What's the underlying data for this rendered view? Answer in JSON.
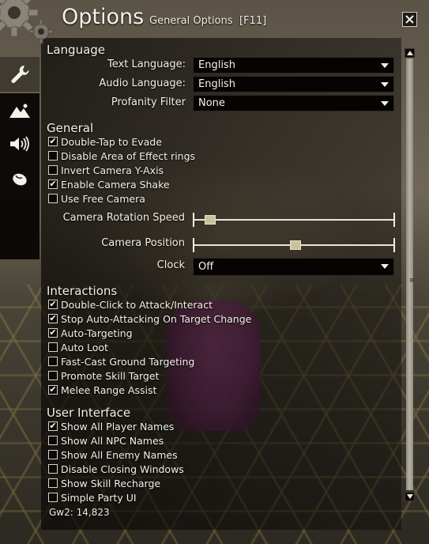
{
  "window": {
    "title": "Options",
    "subtitle": "General Options",
    "hotkey": "[F11]",
    "close_icon": "close-icon"
  },
  "tabs": [
    {
      "icon": "wrench-icon",
      "active": true
    },
    {
      "icon": "mountains-icon",
      "active": false
    },
    {
      "icon": "speaker-icon",
      "active": false
    },
    {
      "icon": "mouse-icon",
      "active": false
    }
  ],
  "language": {
    "heading": "Language",
    "text_language_label": "Text Language:",
    "text_language_value": "English",
    "audio_language_label": "Audio Language:",
    "audio_language_value": "English",
    "profanity_label": "Profanity Filter",
    "profanity_value": "None"
  },
  "general": {
    "heading": "General",
    "checkboxes": [
      {
        "label": "Double-Tap to Evade",
        "checked": true
      },
      {
        "label": "Disable Area of Effect rings",
        "checked": false
      },
      {
        "label": "Invert Camera Y-Axis",
        "checked": false
      },
      {
        "label": "Enable Camera Shake",
        "checked": true
      },
      {
        "label": "Use Free Camera",
        "checked": false
      }
    ],
    "camera_rotation_label": "Camera Rotation Speed",
    "camera_rotation_value": 0.06,
    "camera_position_label": "Camera Position",
    "camera_position_value": 0.51,
    "clock_label": "Clock",
    "clock_value": "Off"
  },
  "interactions": {
    "heading": "Interactions",
    "checkboxes": [
      {
        "label": "Double-Click to Attack/Interact",
        "checked": true
      },
      {
        "label": "Stop Auto-Attacking On Target Change",
        "checked": true
      },
      {
        "label": "Auto-Targeting",
        "checked": true
      },
      {
        "label": "Auto Loot",
        "checked": false
      },
      {
        "label": "Fast-Cast Ground Targeting",
        "checked": false
      },
      {
        "label": "Promote Skill Target",
        "checked": false
      },
      {
        "label": "Melee Range Assist",
        "checked": true
      }
    ]
  },
  "user_interface": {
    "heading": "User Interface",
    "checkboxes": [
      {
        "label": "Show All Player Names",
        "checked": true
      },
      {
        "label": "Show All NPC Names",
        "checked": false
      },
      {
        "label": "Show All Enemy Names",
        "checked": false
      },
      {
        "label": "Disable Closing Windows",
        "checked": false
      },
      {
        "label": "Show Skill Recharge",
        "checked": false
      },
      {
        "label": "Simple Party UI",
        "checked": false
      }
    ]
  },
  "footer": {
    "text": "Gw2: 14,823"
  },
  "colors": {
    "panel_text": "#f3f0e8",
    "dropdown_bg": "#050403",
    "check_border": "#d8d3c8",
    "slider_thumb": "#c9c2a0"
  }
}
